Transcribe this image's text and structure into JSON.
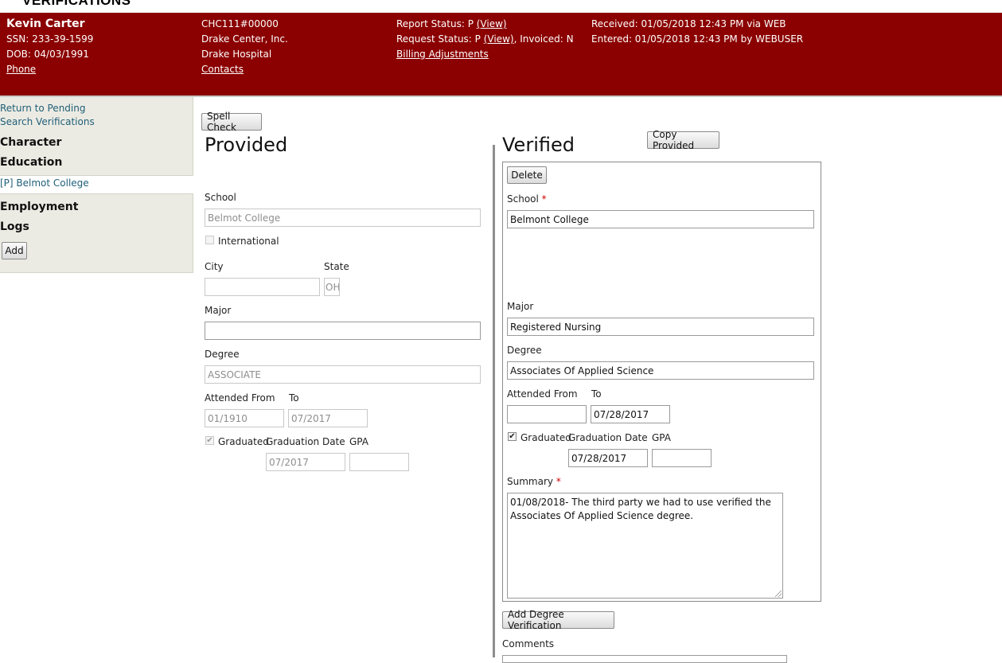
{
  "header": {
    "logo_text": "VERIFICATIONS",
    "candidate_name": "Kevin Carter",
    "ssn": "SSN: 233-39-1599",
    "dob": "DOB: 04/03/1991",
    "phone_link": "Phone",
    "order_id": "CHC111#00000",
    "company": "Drake Center, Inc.",
    "facility": "Drake Hospital",
    "contacts_link": "Contacts",
    "report_status_prefix": "Report Status: P ",
    "report_status_view": "(View)",
    "request_status_prefix": "Request Status: P ",
    "request_status_view": "(View)",
    "invoiced": ", Invoiced: N",
    "billing_link": "Billing Adjustments",
    "received": "Received: 01/05/2018 12:43 PM via WEB",
    "entered": "Entered: 01/05/2018 12:43 PM by WEBUSER"
  },
  "nav": {
    "return_pending": "Return to Pending",
    "search_verifications": "Search Verifications",
    "character": "Character",
    "education": "Education",
    "education_item": "[P] Belmot College",
    "employment": "Employment",
    "logs": "Logs",
    "add_button": "Add"
  },
  "toolbar": {
    "spell_check": "Spell Check",
    "copy_provided": "Copy Provided"
  },
  "provided": {
    "title": "Provided",
    "school_label": "School",
    "school_value": "Belmot College",
    "international_label": "International",
    "city_label": "City",
    "city_value": "",
    "state_label": "State",
    "state_value": "OH",
    "major_label": "Major",
    "major_value": "",
    "degree_label": "Degree",
    "degree_value": "ASSOCIATE",
    "attended_from_label": "Attended From",
    "to_label": "To",
    "from_value": "01/1910",
    "to_value": "07/2017",
    "graduated_label": "Graduated",
    "graduation_date_label": "Graduation Date",
    "gpa_label": "GPA",
    "graduation_date_value": "07/2017",
    "gpa_value": ""
  },
  "verified": {
    "title": "Verified",
    "delete_button": "Delete",
    "school_label": "School",
    "required_mark": "*",
    "school_value": "Belmont College",
    "major_label": "Major",
    "major_value": "Registered Nursing",
    "degree_label": "Degree",
    "degree_value": "Associates Of Applied Science",
    "attended_from_label": "Attended From",
    "to_label": "To",
    "from_value": "",
    "to_value": "07/28/2017",
    "graduated_label": "Graduated",
    "graduation_date_label": "Graduation Date",
    "gpa_label": "GPA",
    "graduation_date_value": "07/28/2017",
    "gpa_value": "",
    "summary_label": "Summary",
    "summary_value": "01/08/2018- The third party we had to use verified the Associates Of Applied Science degree.",
    "add_degree_button": "Add Degree Verification",
    "comments_label": "Comments"
  }
}
